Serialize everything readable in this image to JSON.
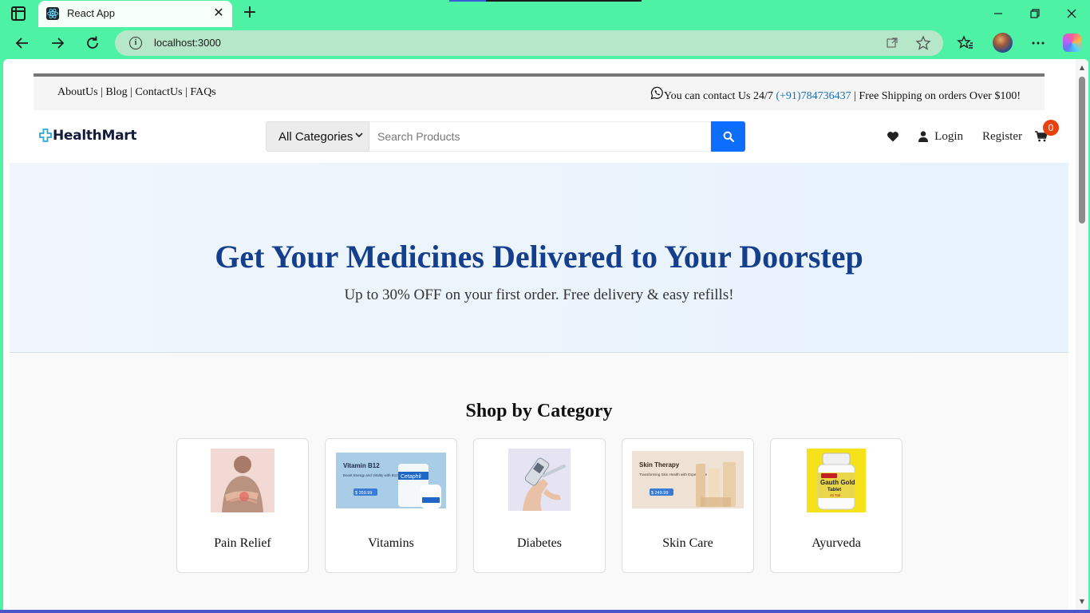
{
  "browser": {
    "tab_title": "React App",
    "url": "localhost:3000",
    "new_tab_symbol": "+",
    "close_symbol": "✕"
  },
  "topbar": {
    "links": [
      "AboutUs",
      "Blog",
      "ContactUs",
      "FAQs"
    ],
    "separator": "|",
    "contact_prefix": "You can contact Us 24/7",
    "phone": "(+91)784736437",
    "shipping_text": "| Free Shipping on orders Over $100!"
  },
  "header": {
    "logo_text": "HealthMart",
    "category_select": "All Categories",
    "search_placeholder": "Search Products",
    "login_label": "Login",
    "register_label": "Register",
    "cart_count": "0"
  },
  "hero": {
    "title": "Get Your Medicines Delivered to Your Doorstep",
    "subtitle": "Up to 30% OFF on your first order. Free delivery & easy refills!"
  },
  "categories": {
    "title": "Shop by Category",
    "items": [
      {
        "label": "Pain Relief"
      },
      {
        "label": "Vitamins",
        "img_heading": "Vitamin B12",
        "img_sub": "Boost Energy and Vitality with B12 Care",
        "img_price": "$ 359.99",
        "img_brand": "Cetaphil"
      },
      {
        "label": "Diabetes"
      },
      {
        "label": "Skin Care",
        "img_heading": "Skin Therapy",
        "img_sub": "Transforming Skin Health with Expert Care",
        "img_price": "$ 249.99"
      },
      {
        "label": "Ayurveda",
        "img_brand": "Gauth Gold",
        "img_sub": "Tablet",
        "img_count": "40 Tab"
      }
    ]
  },
  "colors": {
    "accent": "#0d6efd",
    "hero_title": "#153f8c",
    "badge": "#e8410e",
    "browser_frame": "#4ef2a4"
  }
}
